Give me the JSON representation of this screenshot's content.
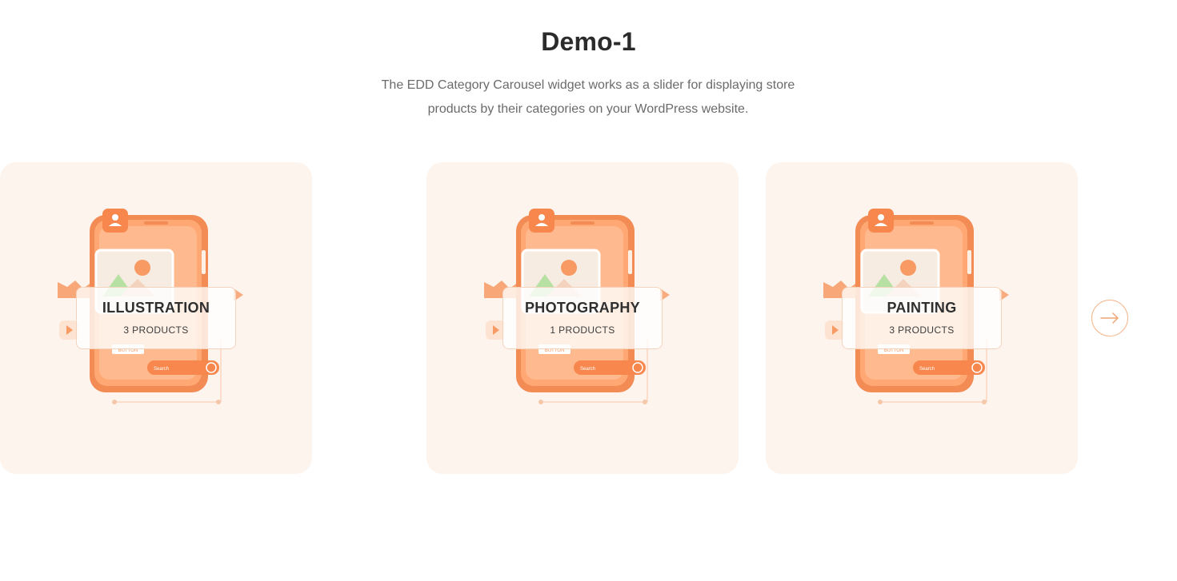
{
  "section": {
    "title": "Demo-1",
    "description_line1": "The EDD Category Carousel widget works as a slider for displaying store",
    "description_line2": "products by their categories on your WordPress website."
  },
  "carousel": {
    "prev_icon": "arrow-left-icon",
    "next_icon": "arrow-right-icon",
    "cards": [
      {
        "name": "PHOTOGRAPHY",
        "count": "1",
        "count_suffix": "PRODUCTS",
        "mockup_button": "BUTTON",
        "mockup_search": "Search"
      },
      {
        "name": "PAINTING",
        "count": "3",
        "count_suffix": "PRODUCTS",
        "mockup_button": "BUTTON",
        "mockup_search": "Search"
      },
      {
        "name": "ILLUSTRATION",
        "count": "3",
        "count_suffix": "PRODUCTS",
        "mockup_button": "BUTTON",
        "mockup_search": "Search"
      }
    ]
  },
  "colors": {
    "card_bg": "#fef4ee",
    "accent": "#f79a63",
    "arrow_border": "#f3b58a"
  }
}
